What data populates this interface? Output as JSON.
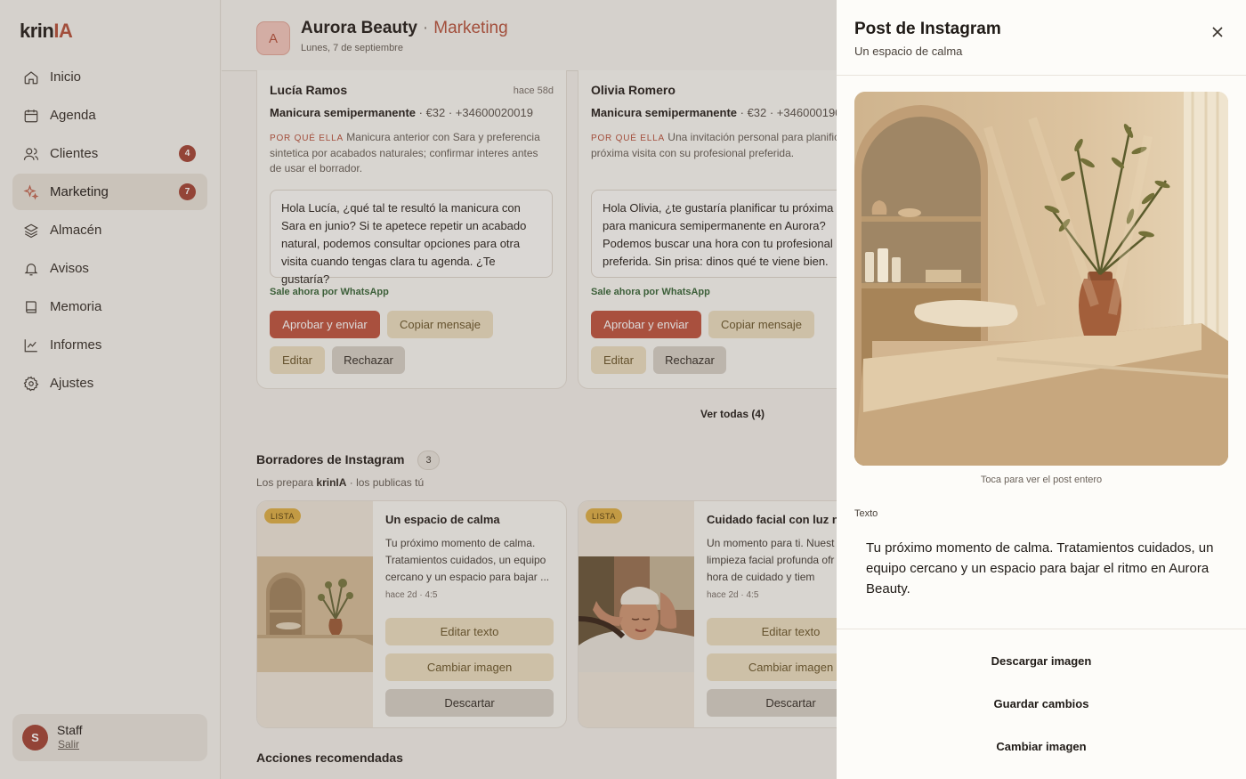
{
  "sidebar": {
    "logo_main": "krin",
    "logo_accent": "IA",
    "items": [
      {
        "label": "Inicio",
        "icon": "home-icon"
      },
      {
        "label": "Agenda",
        "icon": "calendar-icon"
      },
      {
        "label": "Clientes",
        "icon": "users-icon",
        "badge": "4"
      },
      {
        "label": "Marketing",
        "icon": "sparkle-icon",
        "badge": "7",
        "active": true
      },
      {
        "label": "Almacén",
        "icon": "layers-icon"
      },
      {
        "label": "Avisos",
        "icon": "bell-icon"
      },
      {
        "label": "Memoria",
        "icon": "book-icon"
      },
      {
        "label": "Informes",
        "icon": "chart-icon"
      },
      {
        "label": "Ajustes",
        "icon": "gear-icon"
      }
    ],
    "user": {
      "initial": "S",
      "name": "Staff",
      "logout": "Salir"
    }
  },
  "header": {
    "avatar": "A",
    "business": "Aurora Beauty",
    "separator": "·",
    "section": "Marketing",
    "date": "Lunes, 7 de septiembre"
  },
  "clients": [
    {
      "name": "Lucía Ramos",
      "time": "hace 58d",
      "service": "Manicura semipermanente",
      "meta": " · €32 · +34600020019",
      "why_label": "POR QUÉ ELLA",
      "why_text": " Manicura anterior con Sara y preferencia sintetica por acabados naturales; confirmar interes antes de usar el borrador.",
      "message": "Hola Lucía, ¿qué tal te resultó la manicura con Sara en junio? Si te apetece repetir un acabado natural, podemos consultar opciones para otra visita cuando tengas clara tu agenda. ¿Te gustaría?",
      "channel": "Sale ahora por WhatsApp",
      "approve": "Aprobar y enviar",
      "copy": "Copiar mensaje",
      "edit": "Editar",
      "reject": "Rechazar"
    },
    {
      "name": "Olivia Romero",
      "time": "",
      "service": "Manicura semipermanente",
      "meta": " · €32 · +346000190",
      "why_label": "POR QUÉ ELLA",
      "why_text": " Una invitación personal para planifica próxima visita con su profesional preferida.",
      "message": "Hola Olivia, ¿te gustaría planificar tu próxima v para manicura semipermanente en Aurora? Podemos buscar una hora con tu profesional preferida. Sin prisa: dinos qué te viene bien.",
      "channel": "Sale ahora por WhatsApp",
      "approve": "Aprobar y enviar",
      "copy": "Copiar mensaje",
      "edit": "Editar",
      "reject": "Rechazar"
    }
  ],
  "see_all": "Ver todas (4)",
  "instagram": {
    "title": "Borradores de Instagram",
    "count": "3",
    "sub_prefix": "Los prepara ",
    "sub_brand": "krinIA",
    "sub_suffix": " · los publicas tú",
    "drafts": [
      {
        "tag": "LISTA",
        "title": "Un espacio de calma",
        "text": "Tu próximo momento de calma. Tratamientos cuidados, un equipo cercano y un espacio para bajar ...",
        "meta": "hace 2d · 4:5",
        "edit": "Editar texto",
        "change": "Cambiar imagen",
        "discard": "Descartar"
      },
      {
        "tag": "LISTA",
        "title": "Cuidado facial con luz n",
        "text": "Un momento para ti. Nuest limpieza facial profunda ofr una hora de cuidado y tiem",
        "meta": "hace 2d · 4:5",
        "edit": "Editar texto",
        "change": "Cambiar imagen",
        "discard": "Descartar"
      }
    ]
  },
  "recommended_title": "Acciones recomendadas",
  "panel": {
    "title": "Post de Instagram",
    "subtitle": "Un espacio de calma",
    "hint": "Toca para ver el post entero",
    "text_label": "Texto",
    "text": "Tu próximo momento de calma. Tratamientos cuidados, un equipo cercano y un espacio para bajar el ritmo en Aurora Beauty.",
    "actions": {
      "download": "Descargar imagen",
      "save": "Guardar cambios",
      "change": "Cambiar imagen"
    }
  },
  "colors": {
    "accent": "#b9553f",
    "primary_button": "#c15743",
    "tan_button": "#ede0c2",
    "whatsapp_green": "#3c6a3c",
    "badge": "#a7493a"
  }
}
